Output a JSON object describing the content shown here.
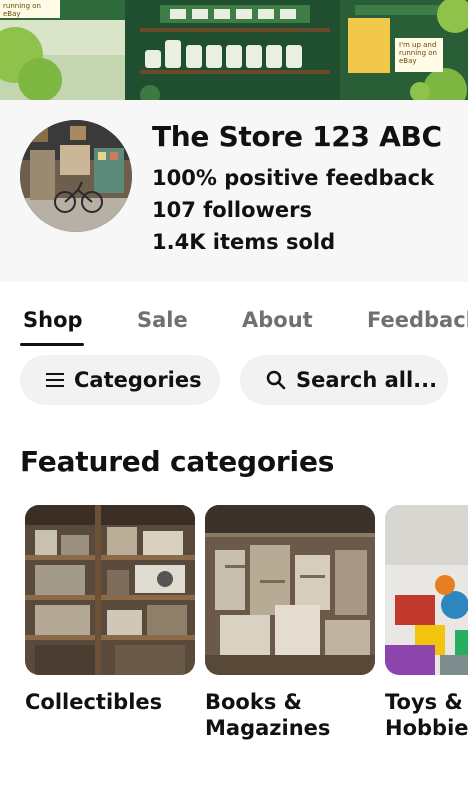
{
  "banner": {
    "tag_left": "running on eBay",
    "tag_right": "I'm up and running on eBay",
    "brand_sign": "ebay"
  },
  "store": {
    "name": "The Store 123 ABC",
    "feedback": "100% positive feedback",
    "followers": "107 followers",
    "items_sold": "1.4K items sold"
  },
  "tabs": [
    {
      "label": "Shop",
      "active": true
    },
    {
      "label": "Sale",
      "active": false
    },
    {
      "label": "About",
      "active": false
    },
    {
      "label": "Feedback",
      "active": false
    }
  ],
  "actions": {
    "categories_label": "Categories",
    "search_label": "Search all..."
  },
  "featured": {
    "title": "Featured categories",
    "items": [
      {
        "label": "Collectibles"
      },
      {
        "label": "Books &\nMagazines"
      },
      {
        "label": "Toys &\nHobbies"
      }
    ]
  },
  "colors": {
    "text": "#111111",
    "muted_tab": "#707070",
    "pill_bg": "#f2f2f2",
    "profile_bg": "#f7f7f7"
  }
}
